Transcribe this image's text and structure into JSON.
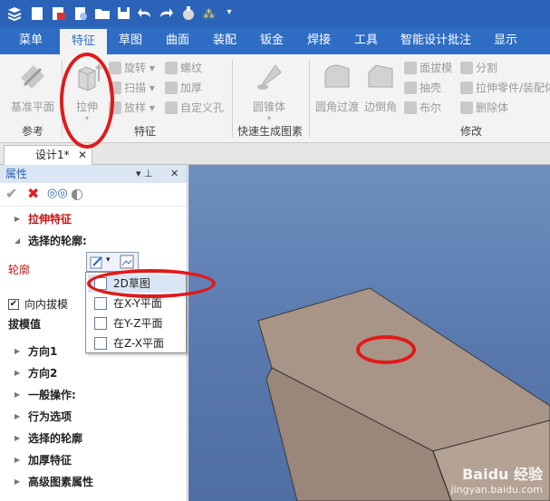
{
  "app": {
    "qat_icons": [
      "app-logo-icon",
      "new-icon",
      "open-red-icon",
      "print-icon",
      "folder-icon",
      "save-icon",
      "undo-icon",
      "redo-icon",
      "material-icon",
      "sparkle-icon",
      "dropdown-icon"
    ]
  },
  "menu": {
    "tabs": [
      {
        "label": "菜单",
        "active": false
      },
      {
        "label": "特征",
        "active": true
      },
      {
        "label": "草图",
        "active": false
      },
      {
        "label": "曲面",
        "active": false
      },
      {
        "label": "装配",
        "active": false
      },
      {
        "label": "钣金",
        "active": false
      },
      {
        "label": "焊接",
        "active": false
      },
      {
        "label": "工具",
        "active": false
      },
      {
        "label": "智能设计批注",
        "active": false
      },
      {
        "label": "显示",
        "active": false
      }
    ]
  },
  "ribbon": {
    "ref_group": {
      "button": "基准平面",
      "label": "参考"
    },
    "feature_group": {
      "extrude": "拉伸",
      "revolve": "旋转",
      "sweep": "扫描",
      "loft": "放样",
      "thread": "螺纹",
      "thicken": "加厚",
      "custom_hole": "自定义孔",
      "label": "特征"
    },
    "quick_group": {
      "button": "圆锥体",
      "label": "快速生成图素"
    },
    "modify_group": {
      "fillet": "圆角过渡",
      "chamfer": "边倒角",
      "draft": "面拔模",
      "shell": "抽壳",
      "boolean": "布尔",
      "split": "分割",
      "pull_part": "拉伸零件/装配体",
      "delete_body": "删除体",
      "label": "修改"
    }
  },
  "doc": {
    "tab_label": "设计1*",
    "close": "✕"
  },
  "panel": {
    "title": "属性",
    "pin": "▾  ⊥",
    "close": "✕",
    "extrude_feature": "拉伸特征",
    "selected_profile_header": "选择的轮廓:",
    "profile_label": "轮廓",
    "inward_draft": "向内拔模",
    "inward_draft_checked": true,
    "draft_value": "拔模值",
    "sections": [
      "方向1",
      "方向2",
      "一般操作:",
      "行为选项",
      "选择的轮廓",
      "加厚特征",
      "高级图素属性"
    ]
  },
  "popup": {
    "items": [
      "2D草图",
      "在X-Y平面",
      "在Y-Z平面",
      "在Z-X平面"
    ],
    "highlighted": 0
  },
  "watermark": {
    "brand": "Baidu 经验",
    "url": "jingyan.baidu.com"
  },
  "colors": {
    "accent": "#2f6dc4",
    "annotation": "#e01a1a",
    "viewport": "#5978ad",
    "block": "#a89587"
  }
}
